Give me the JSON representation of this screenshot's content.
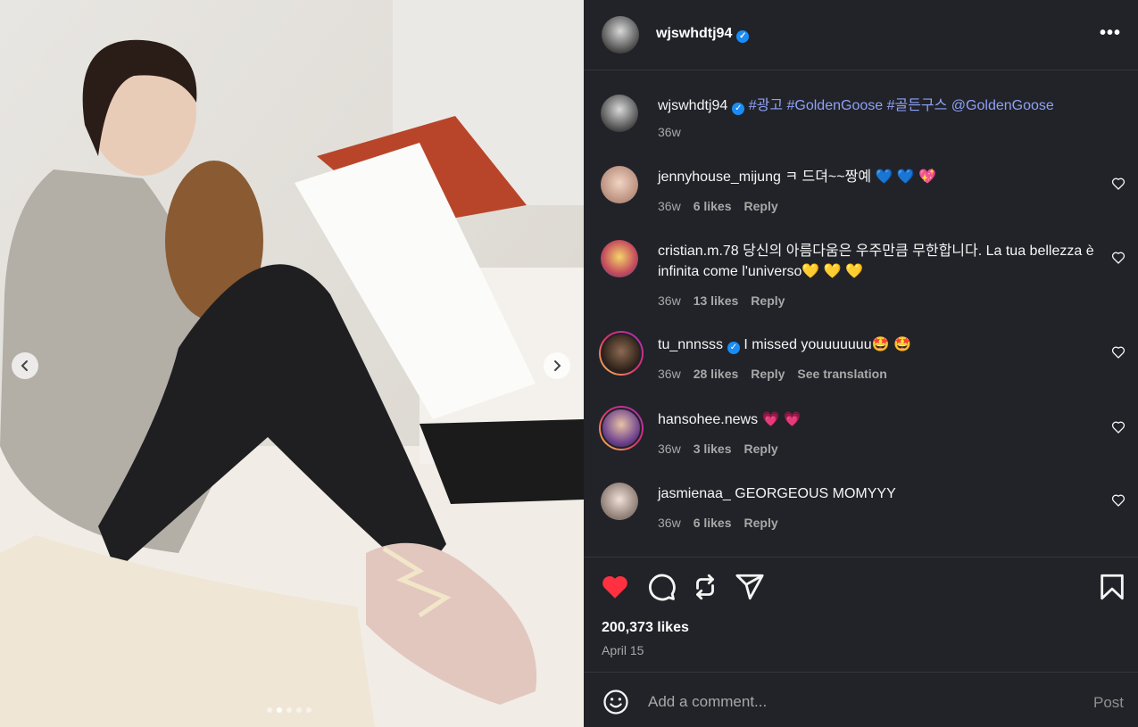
{
  "post": {
    "username": "wjswhdtj94",
    "caption_tags": "#광고 #GoldenGoose #골든구스 @GoldenGoose",
    "caption_age": "36w",
    "likes": "200,373 likes",
    "date": "April 15",
    "carousel": {
      "count": 5,
      "active": 2
    }
  },
  "comments": [
    {
      "user": "jennyhouse_mijung",
      "text": "ㅋ 드뎌~~짱예 💙 💙 💖",
      "age": "36w",
      "likes": "6 likes",
      "reply": "Reply"
    },
    {
      "user": "cristian.m.78",
      "text": "당신의 아름다움은 우주만큼 무한합니다. La tua bellezza è infinita come l'universo💛 💛 💛",
      "age": "36w",
      "likes": "13 likes",
      "reply": "Reply"
    },
    {
      "user": "tu_nnnsss",
      "text": "I missed youuuuuuu🤩 🤩",
      "age": "36w",
      "likes": "28 likes",
      "reply": "Reply",
      "translate": "See translation"
    },
    {
      "user": "hansohee.news",
      "text": "💗 💗",
      "age": "36w",
      "likes": "3 likes",
      "reply": "Reply"
    },
    {
      "user": "jasmienaa_",
      "text": "GEORGEOUS MOMYYY",
      "age": "36w",
      "likes": "6 likes",
      "reply": "Reply"
    }
  ],
  "add_comment": {
    "placeholder": "Add a comment...",
    "post_label": "Post"
  },
  "icons": [
    "heart-icon",
    "comment-icon",
    "repost-icon",
    "share-icon",
    "bookmark-icon",
    "emoji-icon",
    "more-icon",
    "verified-icon"
  ],
  "colors": {
    "liked": "#ff3040",
    "link": "#8ea1f6",
    "verified": "#1a8cf5"
  }
}
